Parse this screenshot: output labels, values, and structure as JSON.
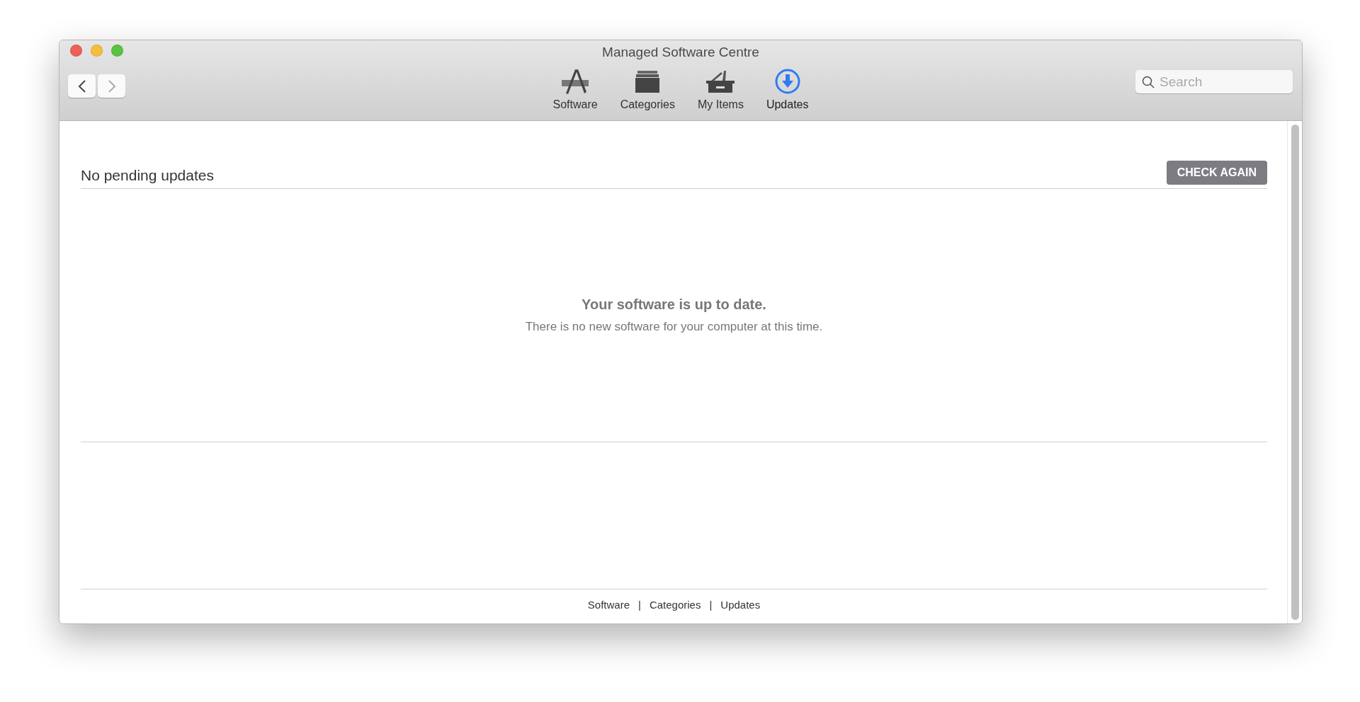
{
  "window": {
    "title": "Managed Software Centre"
  },
  "navigation": {
    "back_enabled": true,
    "forward_enabled": false
  },
  "toolbar_tabs": [
    {
      "kind": "software",
      "label": "Software",
      "selected": false
    },
    {
      "kind": "categories",
      "label": "Categories",
      "selected": false
    },
    {
      "kind": "myitems",
      "label": "My Items",
      "selected": false
    },
    {
      "kind": "updates",
      "label": "Updates",
      "selected": true
    }
  ],
  "search": {
    "placeholder": "Search"
  },
  "header": {
    "title": "No pending updates",
    "button": "CHECK AGAIN"
  },
  "message": {
    "title": "Your software is up to date.",
    "subtitle": "There is no new software for your computer at this time."
  },
  "footer": {
    "links": [
      "Software",
      "Categories",
      "Updates"
    ],
    "separators": [
      "|",
      "|"
    ]
  }
}
